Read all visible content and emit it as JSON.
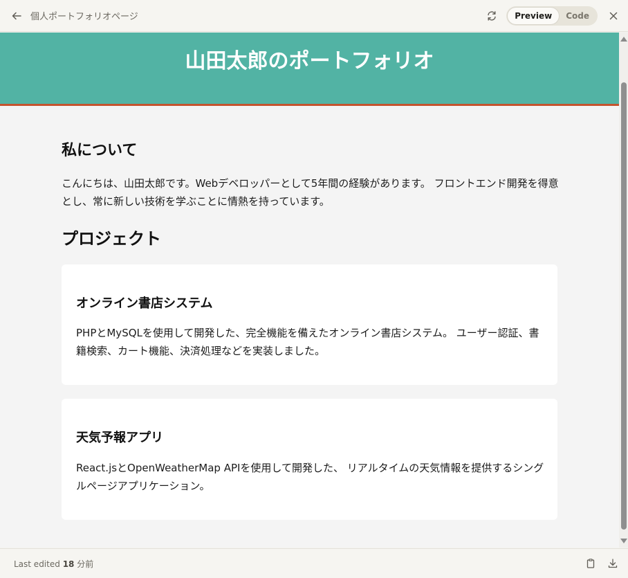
{
  "header": {
    "title": "個人ポートフォリオページ",
    "preview_label": "Preview",
    "code_label": "Code",
    "icons": {
      "back": "arrow-left-icon",
      "refresh": "refresh-icon",
      "close": "close-icon"
    }
  },
  "page": {
    "hero_title": "山田太郎のポートフォリオ",
    "about": {
      "heading": "私について",
      "text": "こんにちは、山田太郎です。Webデベロッパーとして5年間の経験があります。 フロントエンド開発を得意とし、常に新しい技術を学ぶことに情熱を持っています。"
    },
    "projects": {
      "heading": "プロジェクト",
      "items": [
        {
          "title": "オンライン書店システム",
          "description": "PHPとMySQLを使用して開発した、完全機能を備えたオンライン書店システム。 ユーザー認証、書籍検索、カート機能、決済処理などを実装しました。"
        },
        {
          "title": "天気予報アプリ",
          "description": "React.jsとOpenWeatherMap APIを使用して開発した、 リアルタイムの天気情報を提供するシングルページアプリケーション。"
        }
      ]
    },
    "colors": {
      "hero_bg": "#52b3a4",
      "hero_border": "#c4532d",
      "card_bg": "#ffffff",
      "page_bg": "#f4f4f4"
    }
  },
  "footer": {
    "edited_prefix": "Last edited",
    "edited_value": "18",
    "edited_unit": "分前",
    "icons": {
      "copy": "clipboard-icon",
      "download": "download-icon"
    }
  }
}
